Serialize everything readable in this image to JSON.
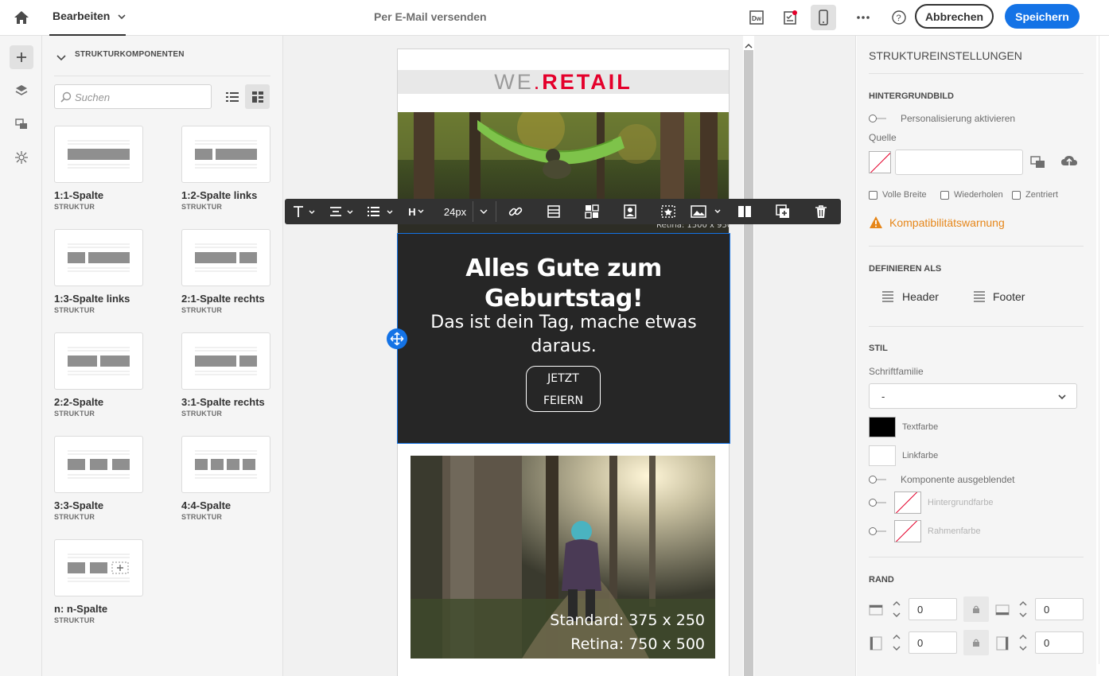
{
  "topbar": {
    "edit_label": "Bearbeiten",
    "title": "Per E-Mail versenden",
    "cancel_label": "Abbrechen",
    "save_label": "Speichern"
  },
  "left_panel": {
    "header": "STRUKTURKOMPONENTEN",
    "search_placeholder": "Suchen",
    "components": [
      {
        "name": "1:1-Spalte",
        "type": "STRUKTUR"
      },
      {
        "name": "1:2-Spalte links",
        "type": "STRUKTUR"
      },
      {
        "name": "1:3-Spalte links",
        "type": "STRUKTUR"
      },
      {
        "name": "2:1-Spalte rechts",
        "type": "STRUKTUR"
      },
      {
        "name": "2:2-Spalte",
        "type": "STRUKTUR"
      },
      {
        "name": "3:1-Spalte rechts",
        "type": "STRUKTUR"
      },
      {
        "name": "3:3-Spalte",
        "type": "STRUKTUR"
      },
      {
        "name": "4:4-Spalte",
        "type": "STRUKTUR"
      },
      {
        "name": "n: n-Spalte",
        "type": "STRUKTUR"
      }
    ]
  },
  "email": {
    "logo_we": "WE",
    "logo_dot": ".",
    "logo_retail": "RETAIL",
    "hero1_caption": "Retina: 1500 x 950",
    "headline": "Alles Gute zum Geburtstag!",
    "subline": "Das ist dein Tag, mache etwas daraus.",
    "cta_line1": "JETZT",
    "cta_line2": "FEIERN",
    "hero2_caption1": "Standard: 375 x 250",
    "hero2_caption2": "Retina: 750 x 500"
  },
  "toolbar": {
    "heading_label": "H",
    "font_size": "24px"
  },
  "right_panel": {
    "title": "STRUKTUREINSTELLUNGEN",
    "bg_image_label": "HINTERGRUNDBILD",
    "personalize_label": "Personalisierung aktivieren",
    "source_label": "Quelle",
    "full_width": "Volle Breite",
    "repeat": "Wiederholen",
    "centered": "Zentriert",
    "compat_warning": "Kompatibilitätswarnung",
    "define_as_label": "DEFINIEREN ALS",
    "header_btn": "Header",
    "footer_btn": "Footer",
    "style_label": "STIL",
    "font_family_label": "Schriftfamilie",
    "font_family_value": "-",
    "text_color_label": "Textfarbe",
    "link_color_label": "Linkfarbe",
    "hidden_label": "Komponente ausgeblendet",
    "bg_color_label": "Hintergrundfarbe",
    "border_color_label": "Rahmenfarbe",
    "border_label": "RAND",
    "border_values": [
      "0",
      "0",
      "0",
      "0"
    ]
  },
  "colors": {
    "accent": "#1473e6",
    "warning": "#e68619",
    "brand_red": "#e4002b",
    "text_color": "#000000",
    "link_color": "#ffffff"
  }
}
